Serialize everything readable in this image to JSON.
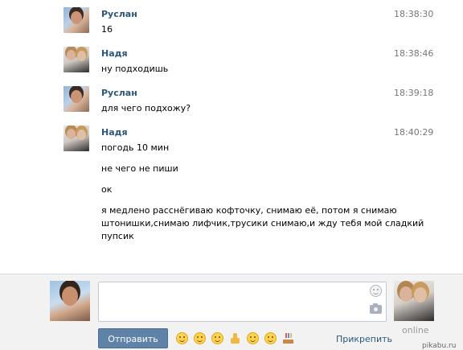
{
  "messages": [
    {
      "author": "Руслан",
      "time": "18:38:30",
      "avatar": "ruslan",
      "lines": [
        "16"
      ]
    },
    {
      "author": "Надя",
      "time": "18:38:46",
      "avatar": "nadya",
      "lines": [
        "ну подходишь"
      ]
    },
    {
      "author": "Руслан",
      "time": "18:39:18",
      "avatar": "ruslan",
      "lines": [
        "для чего подхожу?"
      ]
    },
    {
      "author": "Надя",
      "time": "18:40:29",
      "avatar": "nadya",
      "lines": [
        "погодь 10 мин",
        "не чего не пиши",
        "ок",
        "я медлено расснёгиваю кофточку, снимаю её, потом я снимаю",
        "штонишки,снимаю лифчик,трусики снимаю,и жду тебя мой сладкий",
        "пупсик"
      ]
    }
  ],
  "composer": {
    "input_value": "",
    "send_label": "Отправить",
    "attach_label": "Прикрепить",
    "peer_status": "online",
    "emoji_icons": [
      "smile-emoji-icon",
      "grin-emoji-icon",
      "wink-emoji-icon",
      "thumbs-up-icon",
      "blush-emoji-icon",
      "rolling-eyes-emoji-icon",
      "cake-icon"
    ]
  },
  "watermark": "pikabu.ru",
  "colors": {
    "author": "#2b587a",
    "send_button": "#5e82a8",
    "composer_bg": "#f2f2f2"
  }
}
